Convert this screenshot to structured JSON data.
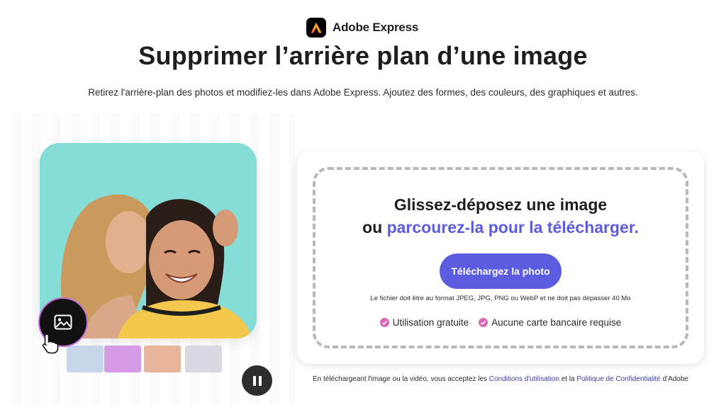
{
  "brand": {
    "name": "Adobe Express",
    "logo_icon": "adobe-express-logo-icon"
  },
  "hero": {
    "title": "Supprimer l’arrière plan d’une image",
    "subtitle": "Retirez l'arrière-plan des photos et modifiez-les dans Adobe Express. Ajoutez des formes, des couleurs, des graphiques et autres."
  },
  "demo": {
    "tool_icon": "image-icon",
    "cursor_icon": "hand-pointer-icon",
    "pause_icon": "pause-icon",
    "thumbnail_colors": [
      "#c8d6ec",
      "#d69ae6",
      "#e8b59a",
      "#d9d9e3"
    ]
  },
  "upload": {
    "line1": "Glissez-déposez une image",
    "line2_prefix": "ou",
    "line2_link": "parcourez-la pour la télécharger.",
    "button_label": "Téléchargez la photo",
    "format_note": "Le fichier doit être au format JPEG, JPG, PNG ou WebP et ne doit pas dépasser 40 Mo",
    "badges": [
      "Utilisation gratuite",
      "Aucune carte bancaire requise"
    ]
  },
  "legal": {
    "prefix": "En téléchargeant l'image ou la vidéo, vous acceptez les",
    "terms_link": "Conditions d'utilisation",
    "middle": "et la",
    "privacy_link": "Politique de Confidentialité",
    "suffix": "d'Adobe"
  },
  "colors": {
    "accent": "#5c5ce0",
    "badge_check": "#d966b8",
    "photo_bg": "#86dcd6",
    "tool_ring": "#c56bd8"
  }
}
